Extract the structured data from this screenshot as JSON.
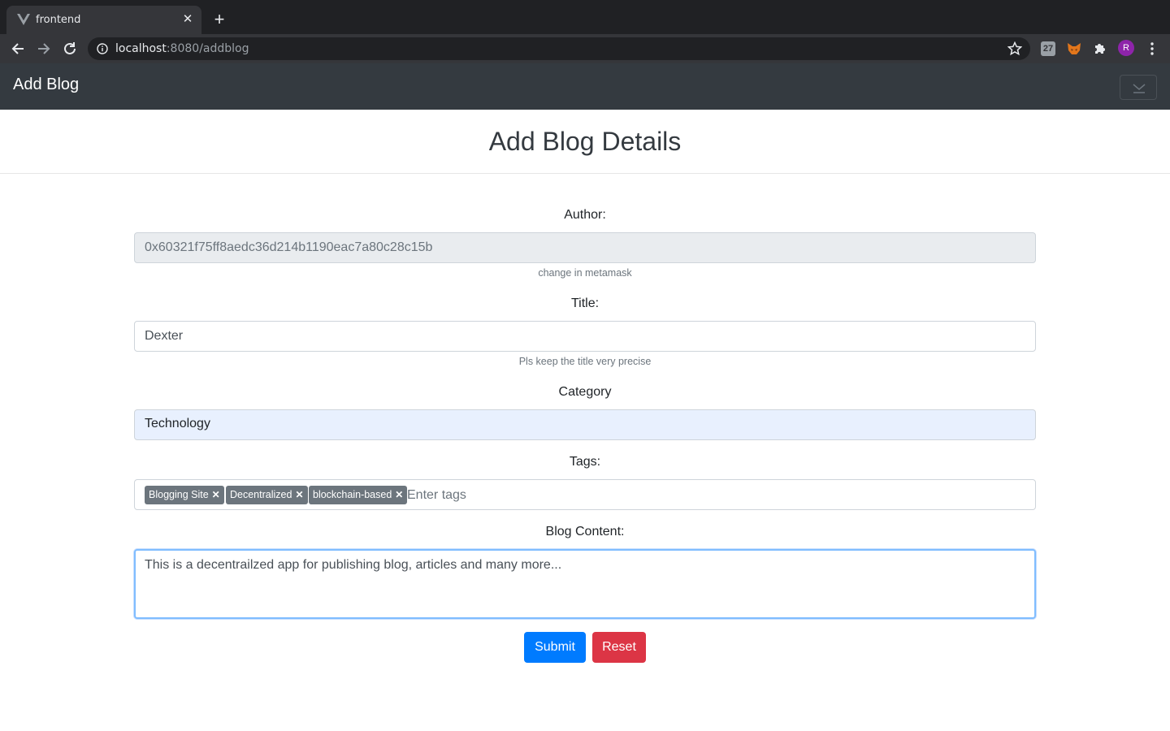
{
  "browser": {
    "tab_title": "frontend",
    "url_host": "localhost",
    "url_path": ":8080/addblog",
    "ext_badge": "27",
    "avatar_letter": "R"
  },
  "navbar": {
    "brand": "Add Blog"
  },
  "page": {
    "title": "Add Blog Details"
  },
  "form": {
    "author": {
      "label": "Author:",
      "value": "0x60321f75ff8aedc36d214b1190eac7a80c28c15b",
      "help": "change in metamask"
    },
    "title": {
      "label": "Title:",
      "value": "Dexter",
      "help": "Pls keep the title very precise"
    },
    "category": {
      "label": "Category",
      "value": "Technology"
    },
    "tags": {
      "label": "Tags:",
      "items": [
        "Blogging Site",
        "Decentralized",
        "blockchain-based"
      ],
      "placeholder": "Enter tags"
    },
    "content": {
      "label": "Blog Content:",
      "value": "This is a decentrailzed app for publishing blog, articles and many more..."
    },
    "submit_label": "Submit",
    "reset_label": "Reset"
  },
  "colors": {
    "primary": "#007bff",
    "danger": "#dc3545",
    "navbar": "#343a40",
    "tag": "#6c757d"
  }
}
